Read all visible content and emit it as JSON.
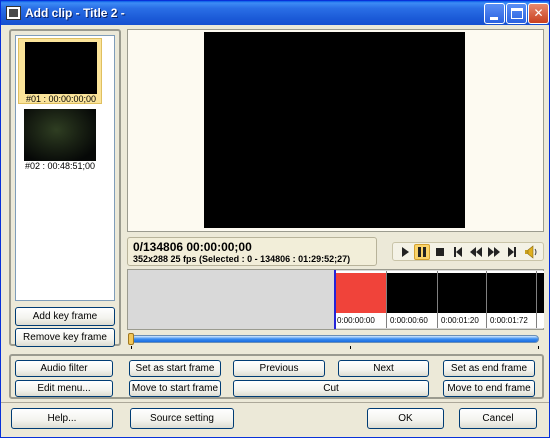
{
  "window": {
    "title": "Add clip - Title 2 -",
    "controls": [
      "minimize-icon",
      "maximize-icon",
      "close-icon"
    ]
  },
  "clips": [
    {
      "label": "#01 : 00:00:00;00",
      "selected": true
    },
    {
      "label": "#02 : 00:48:51;00",
      "selected": false
    }
  ],
  "left_buttons": {
    "add_key_frame": "Add key frame",
    "remove_key_frame": "Remove key frame"
  },
  "info": {
    "frame_time": "0/134806  00:00:00;00",
    "details": "352x288 25 fps  (Selected : 0 - 134806 : 01:29:52;27)"
  },
  "playback_controls": [
    {
      "icon": "play-icon",
      "active": false
    },
    {
      "icon": "pause-icon",
      "active": true
    },
    {
      "icon": "stop-icon",
      "active": false
    },
    {
      "icon": "prev-frame-icon",
      "active": false
    },
    {
      "icon": "rewind-icon",
      "active": false
    },
    {
      "icon": "fast-forward-icon",
      "active": false
    },
    {
      "icon": "next-frame-icon",
      "active": false
    },
    {
      "icon": "volume-icon",
      "active": false
    }
  ],
  "timeline": {
    "frames": [
      "0:00:00:00",
      "0:00:00:60",
      "0:00:01:20",
      "0:00:01:72"
    ]
  },
  "slider": {
    "position": 0.0
  },
  "edit_buttons": {
    "audio_filter": "Audio filter",
    "edit_menu": "Edit menu...",
    "set_start": "Set as start frame",
    "move_start": "Move to start frame",
    "previous": "Previous",
    "next": "Next",
    "cut": "Cut",
    "set_end": "Set as end frame",
    "move_end": "Move to end frame"
  },
  "footer_buttons": {
    "help": "Help...",
    "source_setting": "Source setting",
    "ok": "OK",
    "cancel": "Cancel"
  }
}
